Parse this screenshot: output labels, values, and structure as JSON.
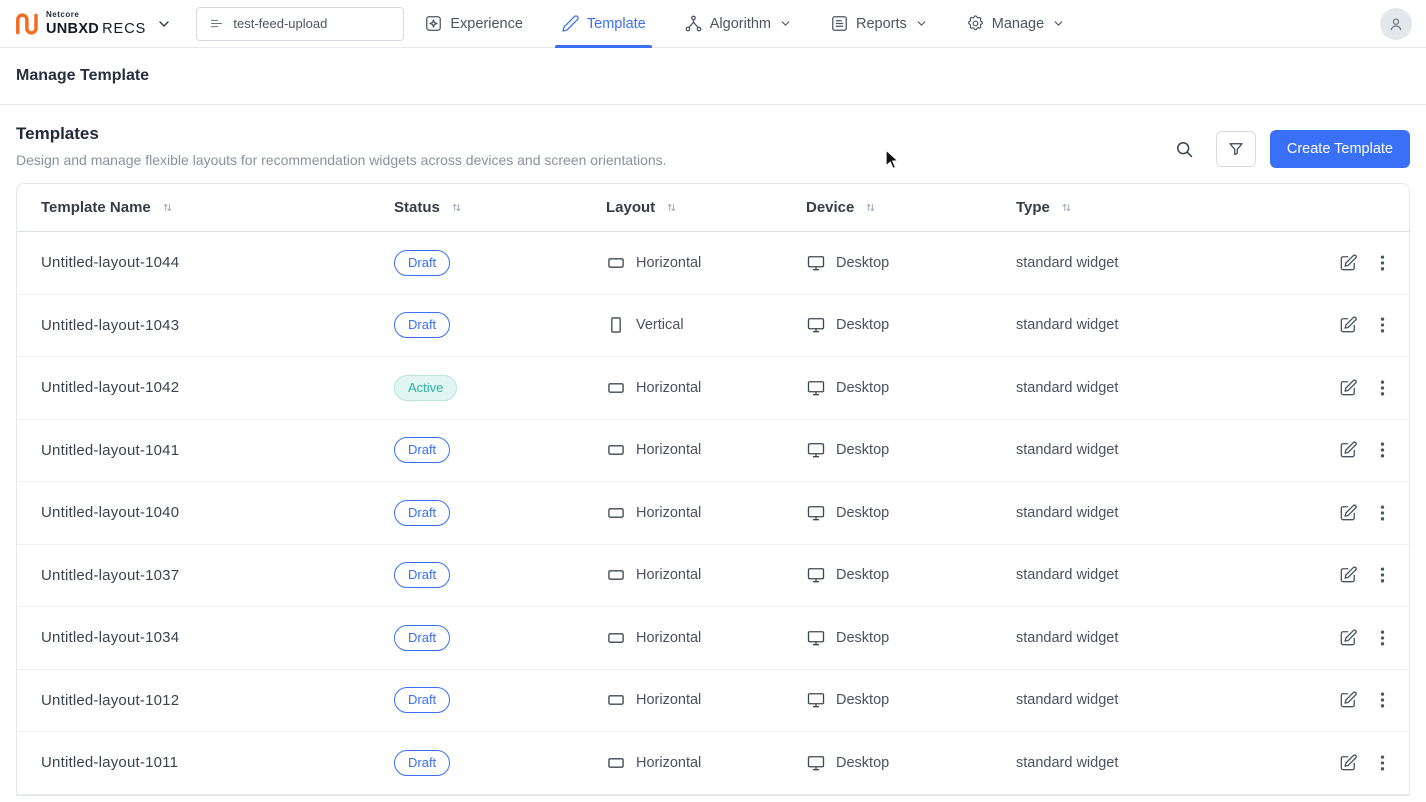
{
  "colors": {
    "accent": "#3a6ff7",
    "active-text": "#2bb3a3",
    "active-bg": "#e1f6f1",
    "active-border": "#b7e8de",
    "logo-orange": "#f26b22"
  },
  "brand": {
    "netcore": "Netcore",
    "unbxd": "UNBXD",
    "recs": "RECS"
  },
  "topbar": {
    "feed_selector": "test-feed-upload",
    "nav": [
      {
        "label": "Experience",
        "active": false,
        "dropdown": false
      },
      {
        "label": "Template",
        "active": true,
        "dropdown": false
      },
      {
        "label": "Algorithm",
        "active": false,
        "dropdown": true
      },
      {
        "label": "Reports",
        "active": false,
        "dropdown": true
      },
      {
        "label": "Manage",
        "active": false,
        "dropdown": true
      }
    ]
  },
  "page": {
    "title": "Manage Template"
  },
  "section": {
    "title": "Templates",
    "subtitle": "Design and manage flexible layouts for recommendation widgets across devices and screen orientations.",
    "create_button": "Create Template"
  },
  "table": {
    "columns": [
      "Template Name",
      "Status",
      "Layout",
      "Device",
      "Type"
    ],
    "rows": [
      {
        "name": "Untitled-layout-1044",
        "status": "Draft",
        "layout": "Horizontal",
        "device": "Desktop",
        "type": "standard widget"
      },
      {
        "name": "Untitled-layout-1043",
        "status": "Draft",
        "layout": "Vertical",
        "device": "Desktop",
        "type": "standard widget"
      },
      {
        "name": "Untitled-layout-1042",
        "status": "Active",
        "layout": "Horizontal",
        "device": "Desktop",
        "type": "standard widget"
      },
      {
        "name": "Untitled-layout-1041",
        "status": "Draft",
        "layout": "Horizontal",
        "device": "Desktop",
        "type": "standard widget"
      },
      {
        "name": "Untitled-layout-1040",
        "status": "Draft",
        "layout": "Horizontal",
        "device": "Desktop",
        "type": "standard widget"
      },
      {
        "name": "Untitled-layout-1037",
        "status": "Draft",
        "layout": "Horizontal",
        "device": "Desktop",
        "type": "standard widget"
      },
      {
        "name": "Untitled-layout-1034",
        "status": "Draft",
        "layout": "Horizontal",
        "device": "Desktop",
        "type": "standard widget"
      },
      {
        "name": "Untitled-layout-1012",
        "status": "Draft",
        "layout": "Horizontal",
        "device": "Desktop",
        "type": "standard widget"
      },
      {
        "name": "Untitled-layout-1011",
        "status": "Draft",
        "layout": "Horizontal",
        "device": "Desktop",
        "type": "standard widget"
      }
    ]
  },
  "icons": {
    "brand_logo": "netcore-mark",
    "brand_chevron": "chevron-down",
    "feed": "list-lines",
    "experience": "box-sparkle",
    "template": "pencil",
    "algorithm": "flow-nodes",
    "reports": "document-lines",
    "manage": "gear",
    "search": "magnifier",
    "filter": "funnel",
    "sort": "up-down-arrows",
    "layout_horizontal": "landscape-rect",
    "layout_vertical": "portrait-rect",
    "device": "monitor",
    "edit": "pencil-square",
    "kebab": "three-dots-vertical",
    "avatar": "person"
  }
}
